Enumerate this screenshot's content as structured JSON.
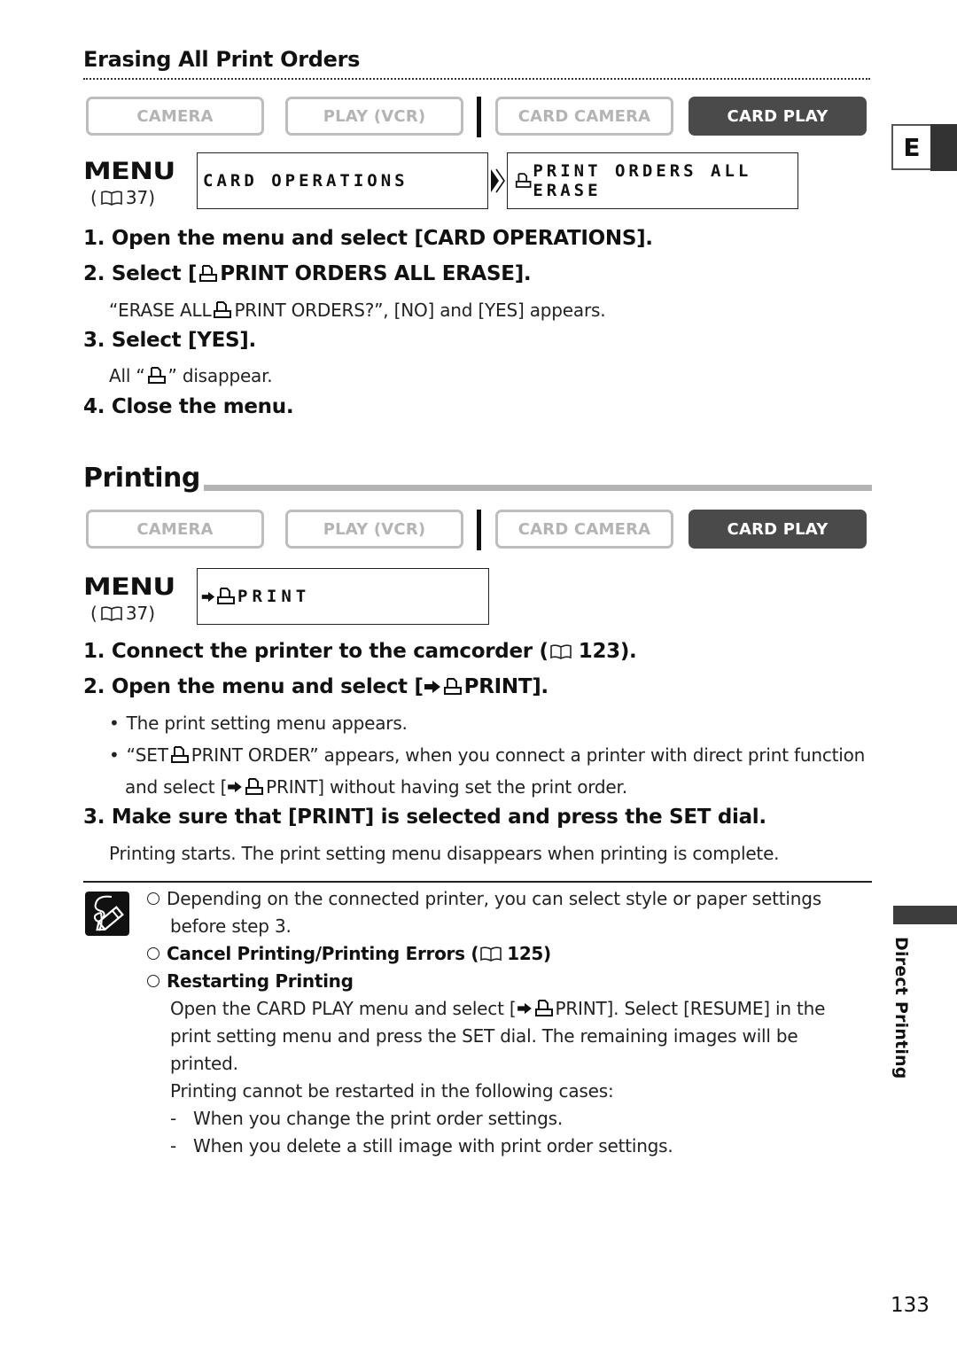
{
  "section_erase": {
    "heading": "Erasing All Print Orders",
    "modes": [
      {
        "label": "CAMERA",
        "active": false
      },
      {
        "label": "PLAY (VCR)",
        "active": false
      },
      {
        "label": "CARD CAMERA",
        "active": false
      },
      {
        "label": "CARD PLAY",
        "active": true
      }
    ],
    "menu": {
      "label": "MENU",
      "ref_open": "(",
      "ref_page": "37)",
      "lcd_items": [
        "CARD OPERATIONS",
        "PRINT ORDERS ALL ERASE"
      ]
    },
    "steps": [
      {
        "number": "1.",
        "text": "Open the menu and select [CARD OPERATIONS]."
      },
      {
        "number": "2.",
        "text_before": "Select [",
        "text_after": "PRINT ORDERS ALL ERASE].",
        "detail_before": "“ERASE ALL ",
        "detail_after": "PRINT ORDERS?”, [NO] and [YES] appears."
      },
      {
        "number": "3.",
        "text": "Select [YES].",
        "detail_before": "All “",
        "detail_after": "” disappear."
      },
      {
        "number": "4.",
        "text": "Close the menu."
      }
    ]
  },
  "section_print": {
    "heading": "Printing",
    "modes": [
      {
        "label": "CAMERA",
        "active": false
      },
      {
        "label": "PLAY (VCR)",
        "active": false
      },
      {
        "label": "CARD CAMERA",
        "active": false
      },
      {
        "label": "CARD PLAY",
        "active": true
      }
    ],
    "menu": {
      "label": "MENU",
      "ref_open": "(",
      "ref_page": "37)",
      "lcd_items": [
        "PRINT"
      ]
    },
    "steps": [
      {
        "number": "1.",
        "text_before": "Connect the printer to the camcorder (",
        "text_after": "123)."
      },
      {
        "number": "2.",
        "text_before": "Open the menu and select [",
        "text_after": "PRINT]."
      },
      {
        "number": "3.",
        "text": "Make sure that [PRINT] is selected and press the SET dial."
      }
    ],
    "step2_bullets": [
      {
        "text": "The print setting menu appears."
      },
      {
        "line1_before": "“SET ",
        "line1_after": "PRINT ORDER” appears, when you connect a printer with direct print function",
        "line2_before": "and select [",
        "line2_after": "PRINT] without having set the print order."
      }
    ],
    "step3_detail": "Printing starts. The print setting menu disappears when printing is complete."
  },
  "notes": {
    "icon": "note-pencil-icon",
    "items": [
      {
        "line1": "Depending on the connected printer, you can select style or paper settings",
        "line2": "before step 3."
      },
      {
        "bold_before": "Cancel Printing/Printing Errors (",
        "bold_after": "125)"
      },
      {
        "bold": "Restarting Printing",
        "line1_before": "Open the CARD PLAY menu and select [",
        "line1_after": "PRINT]. Select [RESUME] in the",
        "line2": "print setting menu and press the SET dial. The remaining images will be",
        "line3": "printed.",
        "line4": "Printing cannot be restarted in the following cases:",
        "cases": [
          "When you change the print order settings.",
          "When you delete a still image with print order settings."
        ]
      }
    ]
  },
  "side": {
    "language_tab": "E",
    "chapter": "Direct Printing"
  },
  "page_number": "133"
}
